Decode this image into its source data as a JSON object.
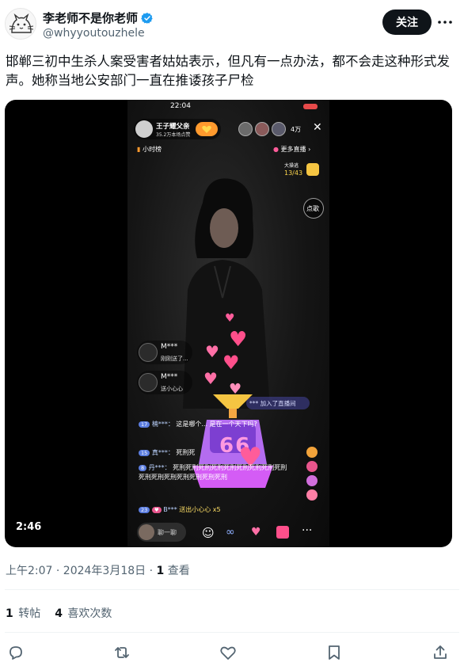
{
  "author": {
    "display_name": "李老师不是你老师",
    "handle": "@whyyoutouzhele",
    "follow_label": "关注"
  },
  "tweet": {
    "text": "邯郸三初中生杀人案受害者姑姑表示，但凡有一点办法，都不会走这种形式发声。她称当地公安部门一直在推诿孩子尸检"
  },
  "video": {
    "duration": "2:46",
    "status_time": "22:04",
    "live": {
      "streamer_name": "王子耀父亲",
      "streamer_likes": "35.2万本场点赞",
      "viewers": "4万",
      "hour_rank": "小时榜",
      "more_live": "更多直播",
      "task_label": "大操逃",
      "task_progress": "13/43",
      "song_button": "点歌",
      "comments": [
        {
          "user": "M***",
          "text": "刚刚送了..."
        },
        {
          "user": "M***",
          "text": "送小心心"
        }
      ],
      "join_notice": "*** 加入了直播间",
      "chat": [
        {
          "level": "17",
          "user": "楠***：",
          "text": "这是哪个... 是在一个天下吗?"
        },
        {
          "level": "15",
          "user": "真***：",
          "text": "死刑死"
        },
        {
          "level": "8",
          "user": "丹***：",
          "text": "死刑死刑死刑死刑死刑死刑死刑死刑死刑死刑死刑死刑死刑死刑死刑死刑"
        },
        {
          "level": "23",
          "user": "B***",
          "text": "送出小心心 x5"
        }
      ],
      "chat_placeholder": "聊一聊",
      "big_number": "66"
    }
  },
  "meta": {
    "time_date": "上午2:07 · 2024年3月18日 · ",
    "views_count": "1",
    "views_label": " 查看"
  },
  "stats": {
    "retweets_count": "1",
    "retweets_label": "转帖",
    "likes_count": "4",
    "likes_label": "喜欢次数"
  },
  "icons": {
    "avatar": "cat-doodle-avatar",
    "verified": "verified-badge-icon",
    "more": "more-dots-icon",
    "reply": "reply-icon",
    "retweet": "retweet-icon",
    "like": "heart-icon",
    "bookmark": "bookmark-icon",
    "share": "share-icon"
  },
  "colors": {
    "verified_blue": "#1d9bf0",
    "text_primary": "#0f1419",
    "text_secondary": "#536471",
    "live_orange": "#ff9a2e",
    "heart_pink": "#ff5c9a"
  }
}
